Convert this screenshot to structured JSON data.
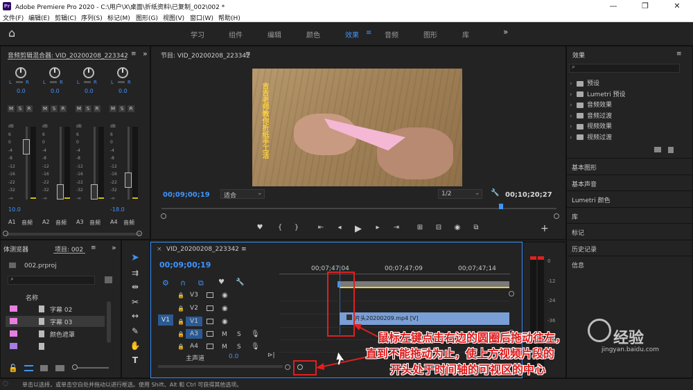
{
  "window": {
    "app_icon": "Pr",
    "title": "Adobe Premiere Pro 2020 - C:\\用户\\X\\桌面\\折纸资料\\已复制_002\\002 *",
    "minimize": "—",
    "maximize": "❐",
    "close": "✕"
  },
  "menu": [
    "文件(F)",
    "编辑(E)",
    "剪辑(C)",
    "序列(S)",
    "标记(M)",
    "图形(G)",
    "视图(V)",
    "窗口(W)",
    "帮助(H)"
  ],
  "workspaces": {
    "home_icon": "⌂",
    "items": [
      "学习",
      "组件",
      "编辑",
      "颜色",
      "效果",
      "音频",
      "图形",
      "库"
    ],
    "active": "效果",
    "menu_icon": "≡",
    "more": "»"
  },
  "mixer": {
    "title": "音频剪辑混合器: VID_20200208_223342",
    "menu_icon": "≡",
    "expand": "»",
    "channels": [
      {
        "pan": "0.0",
        "L": "L",
        "R": "R",
        "fader_value": "10.0",
        "name": "A1",
        "type": "音频",
        "level": 0.78
      },
      {
        "pan": "0.0",
        "L": "L",
        "R": "R",
        "fader_value": "",
        "name": "A2",
        "type": "音频",
        "level": 0
      },
      {
        "pan": "0.0",
        "L": "L",
        "R": "R",
        "fader_value": "",
        "name": "A3",
        "type": "音频",
        "level": 0
      },
      {
        "pan": "0.0",
        "L": "L",
        "R": "R",
        "fader_value": "-18.0",
        "name": "A4",
        "type": "音频",
        "level": 0.2
      }
    ],
    "msr": [
      "M",
      "S",
      "R"
    ],
    "scale": [
      "dB",
      "6",
      "0",
      "-4",
      "-8",
      "-12",
      "-16",
      "-22",
      "-32",
      "-∞"
    ]
  },
  "program": {
    "title": "节目: VID_20200208_223342",
    "menu_icon": "≡",
    "timecode": "00;09;00;19",
    "fit": "适合",
    "resolution": "1/2",
    "duration": "00;10;20;27",
    "overlay_text": "吉吉老师教你折纸手工活",
    "wrench_icon": "🔧",
    "add_icon": "+",
    "transport": [
      "♥",
      "{",
      "}",
      "⇤",
      "◂",
      "▶",
      "▸",
      "⇥",
      "⊞",
      "⊟",
      "◉",
      "⧉"
    ]
  },
  "project": {
    "tab1": "体测览器",
    "tab2": "项目: 002",
    "menu_icon": "≡",
    "expand": "»",
    "file": "002.prproj",
    "search_placeholder": "",
    "column": "名称",
    "items": [
      {
        "name": "字幕 02",
        "color": "#e87ee0"
      },
      {
        "name": "字幕 03",
        "color": "#e87ee0"
      },
      {
        "name": "颜色遮罩",
        "color": "#e87ee0"
      },
      {
        "name": "",
        "color": "#a67ee0"
      }
    ]
  },
  "timeline": {
    "close_icon": "×",
    "title": "VID_20200208_223342",
    "menu_icon": "≡",
    "timecode": "00;09;00;19",
    "ruler": [
      "00;07;47;04",
      "00;07;47;09",
      "00;07;47;14"
    ],
    "tracks": [
      {
        "id": "V3",
        "src": "",
        "kind": "video"
      },
      {
        "id": "V2",
        "src": "",
        "kind": "video"
      },
      {
        "id": "V1",
        "src": "V1",
        "kind": "video"
      },
      {
        "id": "A3",
        "src": "",
        "kind": "audio",
        "m": "M",
        "s": "S"
      },
      {
        "id": "A4",
        "src": "",
        "kind": "audio",
        "m": "M",
        "s": "S"
      }
    ],
    "master": "主声道",
    "master_value": "0.0",
    "clip_label": "片头20200209.mp4 [V]"
  },
  "meter_scale": [
    "0",
    "-12",
    "-24",
    "-36",
    "-48"
  ],
  "effects": {
    "title": "效果",
    "menu_icon": "≡",
    "items": [
      "预设",
      "Lumetri 预设",
      "音频效果",
      "音频过渡",
      "视频效果",
      "视频过渡"
    ],
    "sections": [
      "基本图形",
      "基本声音",
      "Lumetri 颜色",
      "库",
      "标记",
      "历史记录",
      "信息"
    ]
  },
  "status": "单击以选择，或单击空白处并拖动以进行框选。使用 Shift、Alt 和 Ctrl 可获得其他选项。",
  "annotation": {
    "line1": "鼠标左键点击右边的圆圈后拖动往左，",
    "line2": "直到不能拖动为止，使上方视频片段的",
    "line3": "开头处于时间轴的可视区的中心"
  },
  "watermark": "经验",
  "watermark_sub": "jingyan.baidu.com",
  "colors": {
    "accent": "#3e95ff",
    "annotation": "#e01818",
    "clip": "#7a9fd6",
    "label": "#e87ee0"
  }
}
